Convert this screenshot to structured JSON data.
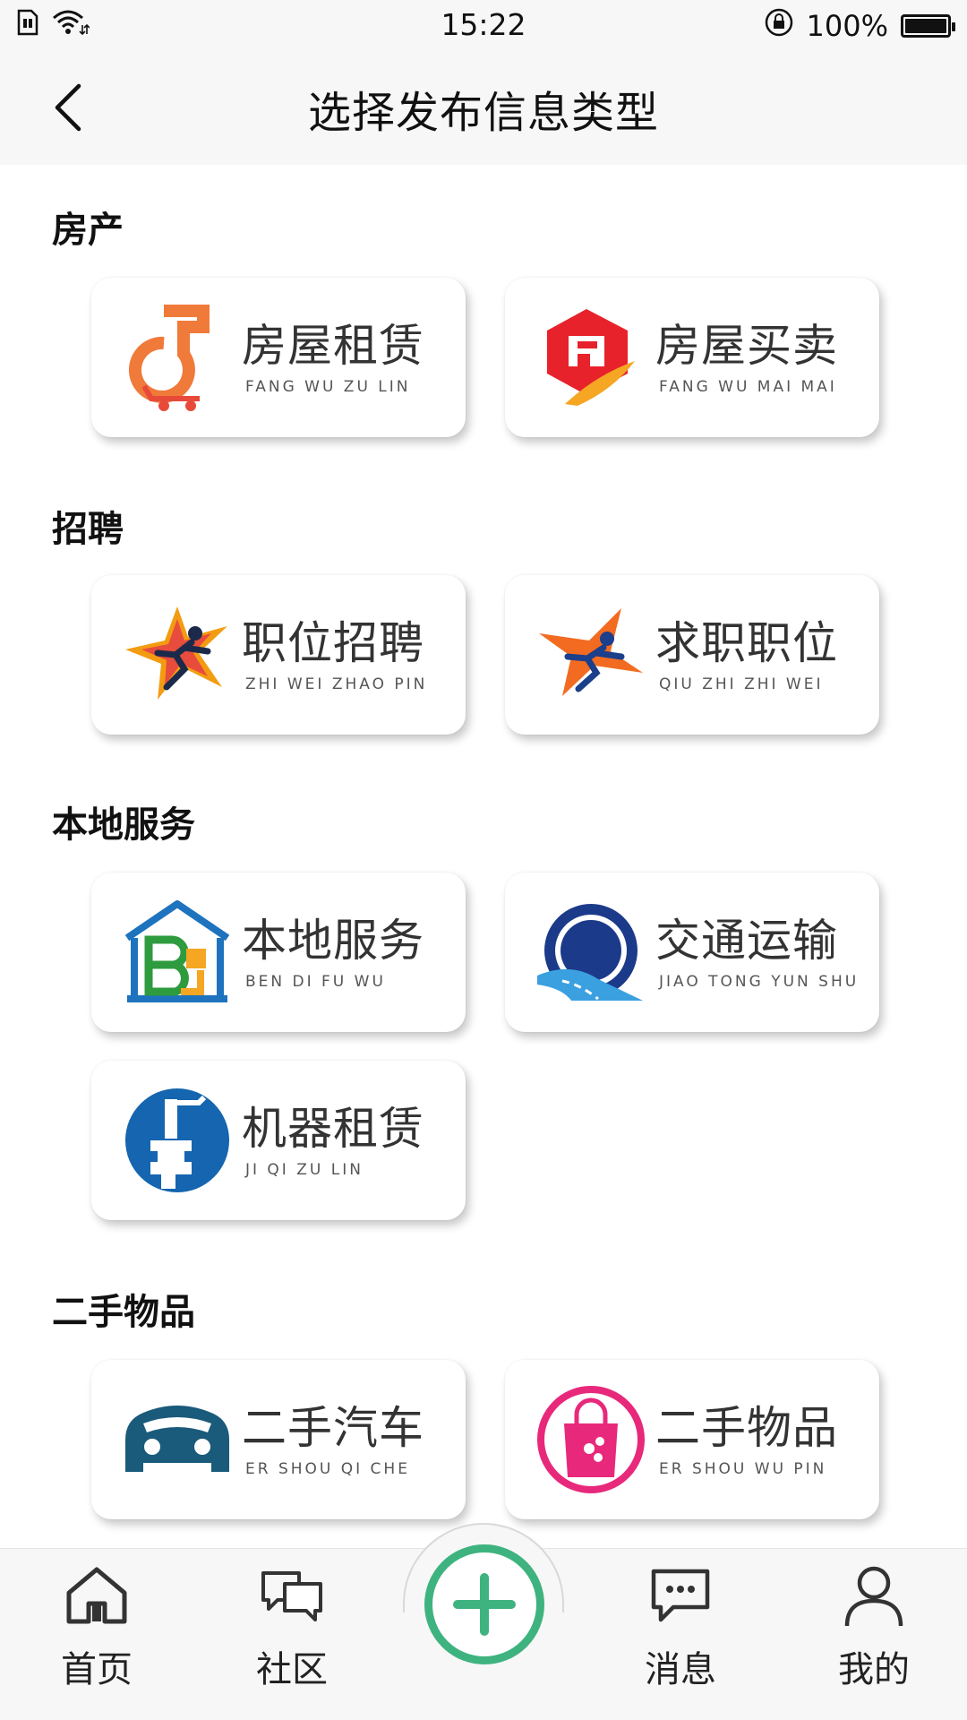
{
  "status_bar": {
    "time": "15:22",
    "battery": "100%",
    "icons": [
      "sim-icon",
      "wifi-icon",
      "lock-rotation-icon",
      "battery-icon"
    ]
  },
  "header": {
    "title": "选择发布信息类型",
    "back_icon": "chevron-left-icon"
  },
  "sections": [
    {
      "title": "房产",
      "items": [
        {
          "cn": "房屋租赁",
          "py": "FANG WU ZU LIN",
          "icon": "key-cart-icon"
        },
        {
          "cn": "房屋买卖",
          "py": "FANG WU MAI MAI",
          "icon": "house-hexagon-icon"
        }
      ]
    },
    {
      "title": "招聘",
      "items": [
        {
          "cn": "职位招聘",
          "py": "ZHI WEI ZHAO PIN",
          "icon": "runner-star-icon"
        },
        {
          "cn": "求职职位",
          "py": "QIU ZHI ZHI WEI",
          "icon": "runner-arrow-icon"
        }
      ]
    },
    {
      "title": "本地服务",
      "items": [
        {
          "cn": "本地服务",
          "py": "BEN DI FU WU",
          "icon": "house-b-icon"
        },
        {
          "cn": "交通运输",
          "py": "JIAO TONG YUN SHU",
          "icon": "road-tunnel-icon"
        },
        {
          "cn": "机器租赁",
          "py": "JI QI ZU LIN",
          "icon": "machine-circle-icon"
        }
      ]
    },
    {
      "title": "二手物品",
      "items": [
        {
          "cn": "二手汽车",
          "py": "ER SHOU QI CHE",
          "icon": "car-front-icon"
        },
        {
          "cn": "二手物品",
          "py": "ER SHOU WU PIN",
          "icon": "shopping-bag-icon"
        }
      ]
    }
  ],
  "tabbar": {
    "items": [
      {
        "label": "首页",
        "icon": "home-icon"
      },
      {
        "label": "社区",
        "icon": "chat-bubbles-icon"
      },
      {
        "label": "消息",
        "icon": "message-icon"
      },
      {
        "label": "我的",
        "icon": "user-icon"
      }
    ],
    "center_icon": "plus-circle-icon",
    "accent": "#3fb37f"
  }
}
